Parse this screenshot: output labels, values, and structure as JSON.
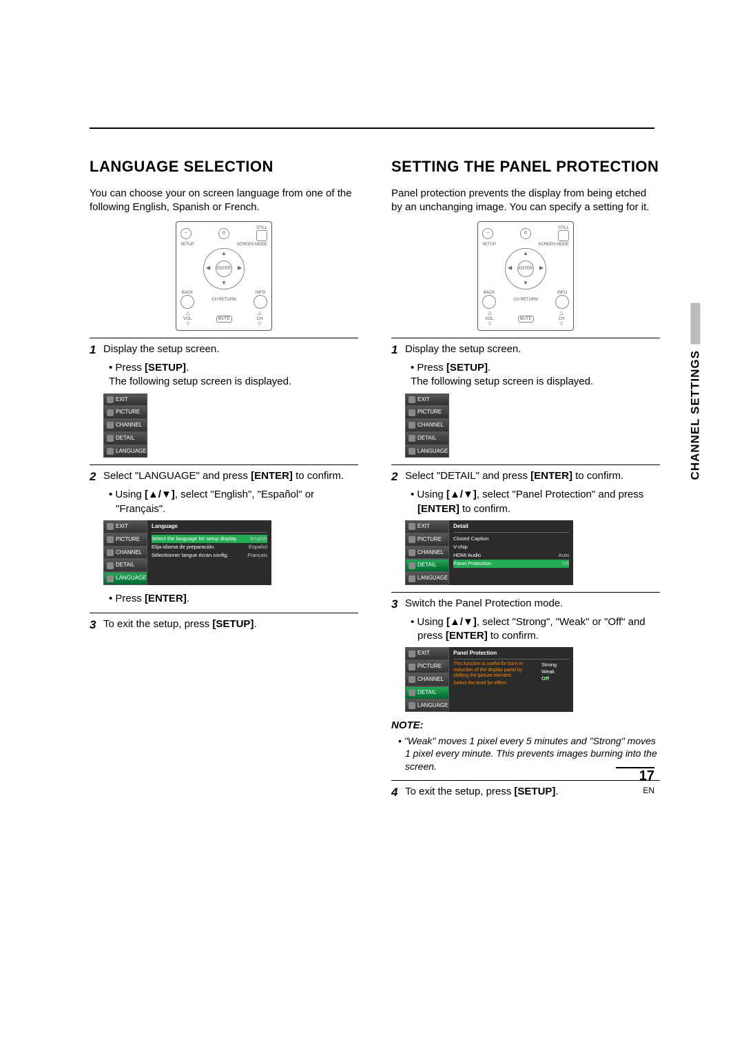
{
  "side_tab": "CHANNEL SETTINGS",
  "page_number": "17",
  "page_lang": "EN",
  "left": {
    "heading": "LANGUAGE SELECTION",
    "intro": "You can choose your on screen language from one of the following English, Spanish or French.",
    "step1_text": "Display the setup screen.",
    "step1_b_pre": "Press ",
    "step1_b_bold": "[SETUP]",
    "step1_b_post": ".",
    "step1_sub": "The following setup screen is displayed.",
    "step2_pre": "Select \"LANGUAGE\" and press ",
    "step2_bold": "[ENTER]",
    "step2_post": " to confirm.",
    "step2_b_pre": "Using ",
    "step2_b_bold": "[▲/▼]",
    "step2_b_post": ", select \"English\", \"Español\" or \"Français\".",
    "step2_c_pre": "Press ",
    "step2_c_bold": "[ENTER]",
    "step2_c_post": ".",
    "step3_pre": "To exit the setup, press ",
    "step3_bold": "[SETUP]",
    "step3_post": ".",
    "osd_side": [
      "EXIT",
      "PICTURE",
      "CHANNEL",
      "DETAIL",
      "LANGUAGE"
    ],
    "osd2_title": "Language",
    "osd2_rows": [
      {
        "label": "Select the language for setup display.",
        "val": "English"
      },
      {
        "label": "Elija idioma de preparación.",
        "val": "Español"
      },
      {
        "label": "Sélectionner langue écran config.",
        "val": "Français"
      }
    ]
  },
  "right": {
    "heading": "SETTING THE PANEL PROTECTION",
    "intro": "Panel protection prevents the display from being etched by an unchanging image. You can specify a setting for it.",
    "step1_text": "Display the setup screen.",
    "step1_b_pre": "Press ",
    "step1_b_bold": "[SETUP]",
    "step1_b_post": ".",
    "step1_sub": "The following setup screen is displayed.",
    "step2_pre": "Select \"DETAIL\" and press ",
    "step2_bold": "[ENTER]",
    "step2_post": " to confirm.",
    "step2_b_pre": "Using ",
    "step2_b_bold": "[▲/▼]",
    "step2_b_post": ", select \"Panel Protection\" and press ",
    "step2_b_bold2": "[ENTER]",
    "step2_b_post2": " to confirm.",
    "osd2_title": "Detail",
    "osd2_rows": [
      {
        "label": "Closed Caption",
        "val": ""
      },
      {
        "label": "V-chip",
        "val": ""
      },
      {
        "label": "HDMI Audio",
        "val": "Auto"
      },
      {
        "label": "Panel Protection",
        "val": "Off"
      }
    ],
    "step3_text": "Switch the Panel Protection mode.",
    "step3_b_pre": "Using ",
    "step3_b_bold": "[▲/▼]",
    "step3_b_post": ", select \"Strong\", \"Weak\" or \"Off\" and press ",
    "step3_b_bold2": "[ENTER]",
    "step3_b_post2": " to confirm.",
    "osd3_title": "Panel Protection",
    "osd3_desc1": "This function is useful for burn-in reduction of the display panel by shifting the picture element.",
    "osd3_desc2": "Select the level for effect.",
    "osd3_opts": [
      "Strong",
      "Weak",
      "Off"
    ],
    "note_head": "NOTE:",
    "note_body": "\"Weak\" moves 1 pixel every 5 minutes and \"Strong\" moves 1 pixel every minute. This prevents images burning into the screen.",
    "step4_pre": "To exit the setup, press ",
    "step4_bold": "[SETUP]",
    "step4_post": "."
  },
  "remote": {
    "still": "STILL",
    "screen": "SCREEN MODE",
    "setup": "SETUP",
    "enter": "ENTER",
    "back": "BACK",
    "info": "INFO",
    "chret": "CH RETURN",
    "vol": "VOL.",
    "ch": "CH",
    "mute": "MUTE"
  }
}
